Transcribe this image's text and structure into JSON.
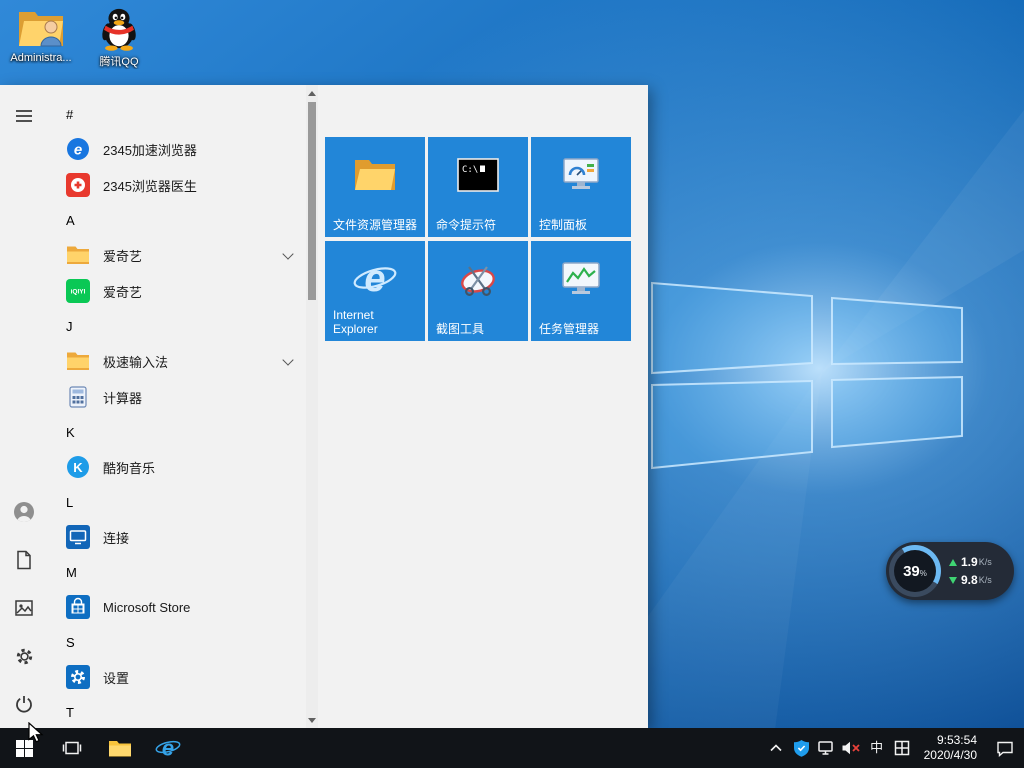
{
  "desktop": {
    "icons": [
      {
        "label": "Administra...",
        "icon": "administrator-folder"
      },
      {
        "label": "腾讯QQ",
        "icon": "qq-penguin"
      }
    ]
  },
  "start_menu": {
    "app_list": [
      {
        "type": "header",
        "label": "#"
      },
      {
        "type": "app",
        "label": "2345加速浏览器"
      },
      {
        "type": "app",
        "label": "2345浏览器医生"
      },
      {
        "type": "header",
        "label": "A"
      },
      {
        "type": "app",
        "label": "爱奇艺",
        "folder_group": true
      },
      {
        "type": "app",
        "label": "爱奇艺"
      },
      {
        "type": "header",
        "label": "J"
      },
      {
        "type": "app",
        "label": "极速输入法",
        "folder_group": true
      },
      {
        "type": "app",
        "label": "计算器"
      },
      {
        "type": "header",
        "label": "K"
      },
      {
        "type": "app",
        "label": "酷狗音乐"
      },
      {
        "type": "header",
        "label": "L"
      },
      {
        "type": "app",
        "label": "连接"
      },
      {
        "type": "header",
        "label": "M"
      },
      {
        "type": "app",
        "label": "Microsoft Store"
      },
      {
        "type": "header",
        "label": "S"
      },
      {
        "type": "app",
        "label": "设置"
      },
      {
        "type": "header",
        "label": "T"
      }
    ],
    "tiles": [
      {
        "label": "文件资源管理器"
      },
      {
        "label": "命令提示符"
      },
      {
        "label": "控制面板"
      },
      {
        "label": "Internet Explorer"
      },
      {
        "label": "截图工具"
      },
      {
        "label": "任务管理器"
      }
    ]
  },
  "taskbar": {
    "tray": {
      "time": "9:53:54",
      "date": "2020/4/30",
      "ime": "中"
    }
  },
  "net_monitor": {
    "percent": "39",
    "percent_unit": "%",
    "upload_value": "1.9",
    "download_value": "9.8",
    "speed_unit": "K/s"
  },
  "icon_glyphs": {
    "browser_2345": "e",
    "iqiyi": "iQIYI",
    "kugou": "K",
    "cmd": "C:\\",
    "ie": "e",
    "edge": "e"
  },
  "colors": {
    "accent": "#0078d7",
    "tile_blue": "#2286d8",
    "taskbar": "#111418",
    "menu_bg": "#f2f2f2"
  }
}
